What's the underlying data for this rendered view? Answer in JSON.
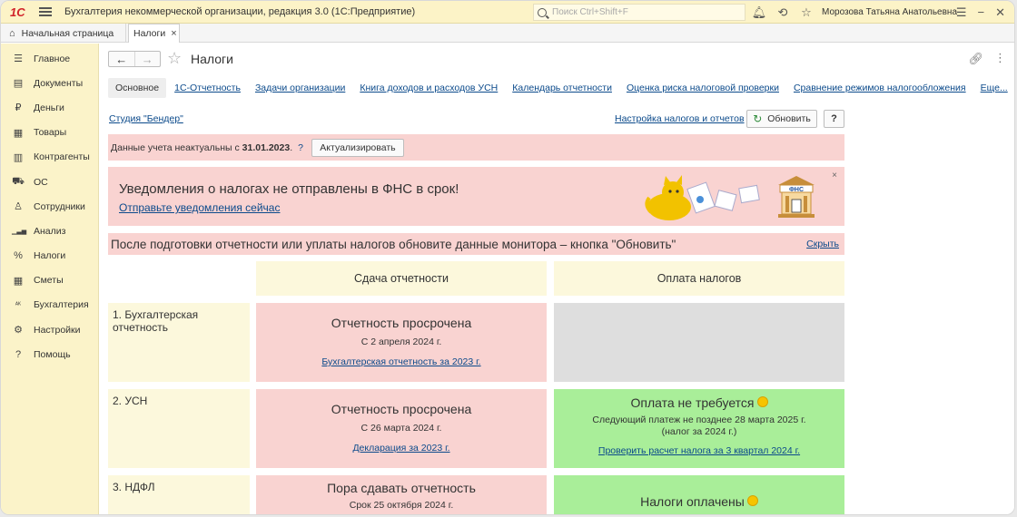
{
  "topbar": {
    "logo": "1С",
    "app_title": "Бухгалтерия некоммерческой организации, редакция 3.0  (1С:Предприятие)",
    "search_placeholder": "Поиск Ctrl+Shift+F",
    "username": "Морозова Татьяна Анатольевна"
  },
  "tabs": {
    "home_label": "Начальная страница",
    "active_label": "Налоги"
  },
  "sidebar": {
    "items": [
      {
        "label": "Главное",
        "icon": "menu-lines-icon",
        "glyph": "☰"
      },
      {
        "label": "Документы",
        "icon": "document-icon",
        "glyph": "▤"
      },
      {
        "label": "Деньги",
        "icon": "ruble-icon",
        "glyph": "₽"
      },
      {
        "label": "Товары",
        "icon": "boxes-icon",
        "glyph": "▦"
      },
      {
        "label": "Контрагенты",
        "icon": "building-icon",
        "glyph": "▥"
      },
      {
        "label": "ОС",
        "icon": "truck-icon",
        "glyph": "⛟"
      },
      {
        "label": "Сотрудники",
        "icon": "person-icon",
        "glyph": "♙"
      },
      {
        "label": "Анализ",
        "icon": "bar-chart-icon",
        "glyph": "▁▃▅"
      },
      {
        "label": "Налоги",
        "icon": "percent-icon",
        "glyph": "%"
      },
      {
        "label": "Сметы",
        "icon": "calculator-icon",
        "glyph": "▦"
      },
      {
        "label": "Бухгалтерия",
        "icon": "accounting-icon",
        "glyph": "ᴬᴷ"
      },
      {
        "label": "Настройки",
        "icon": "gear-icon",
        "glyph": "⚙"
      },
      {
        "label": "Помощь",
        "icon": "question-icon",
        "glyph": "?"
      }
    ]
  },
  "page": {
    "title": "Налоги",
    "subtabs": [
      {
        "label": "Основное",
        "active": true
      },
      {
        "label": "1С-Отчетность"
      },
      {
        "label": "Задачи организации"
      },
      {
        "label": "Книга доходов и расходов УСН"
      },
      {
        "label": "Календарь отчетности"
      },
      {
        "label": "Оценка риска налоговой проверки"
      },
      {
        "label": "Сравнение режимов налогообложения"
      }
    ],
    "more_label": "Еще...",
    "org_link": "Студия \"Бендер\"",
    "settings_link": "Настройка налогов и отчетов",
    "refresh_label": "Обновить",
    "help_label": "?"
  },
  "warning": {
    "text_prefix": "Данные учета неактуальны с ",
    "date": "31.01.2023",
    "text_suffix": ".",
    "question": "?",
    "button": "Актуализировать"
  },
  "notice": {
    "title": "Уведомления о налогах не отправлены в ФНС в срок!",
    "link": "Отправьте уведомления сейчас",
    "close": "×",
    "badge": "ФНС"
  },
  "hint": {
    "text": "После подготовки отчетности или уплаты налогов обновите данные монитора – кнопка \"Обновить\"",
    "hide_link": "Скрыть"
  },
  "grid": {
    "col1": "Сдача отчетности",
    "col2": "Оплата налогов",
    "rows": [
      {
        "label": "1. Бухгалтерская отчетность",
        "report": {
          "title": "Отчетность просрочена",
          "sub": "С 2 апреля 2024 г.",
          "link": "Бухгалтерская отчетность за 2023 г."
        },
        "payment": {
          "status": "empty"
        }
      },
      {
        "label": "2. УСН",
        "report": {
          "title": "Отчетность просрочена",
          "sub": "С 26 марта 2024 г.",
          "link": "Декларация за 2023 г."
        },
        "payment": {
          "title": "Оплата не требуется",
          "sub1": "Следующий платеж не позднее 28 марта 2025 г.",
          "sub2": "(налог за 2024 г.)",
          "link": "Проверить расчет налога за 3 квартал 2024 г."
        }
      },
      {
        "label": "3. НДФЛ",
        "report": {
          "title": "Пора сдавать отчетность",
          "sub": "Срок 25 октября 2024 г."
        },
        "payment": {
          "title": "Налоги оплачены"
        }
      }
    ]
  },
  "colors": {
    "topbar_bg": "#fcf3c7",
    "sidebar_bg": "#fbf3c9",
    "alert_bg": "#f9d3d1",
    "ok_bg": "#a9ee99",
    "header_bg": "#fcf8dc",
    "link": "#0b4a8b"
  }
}
